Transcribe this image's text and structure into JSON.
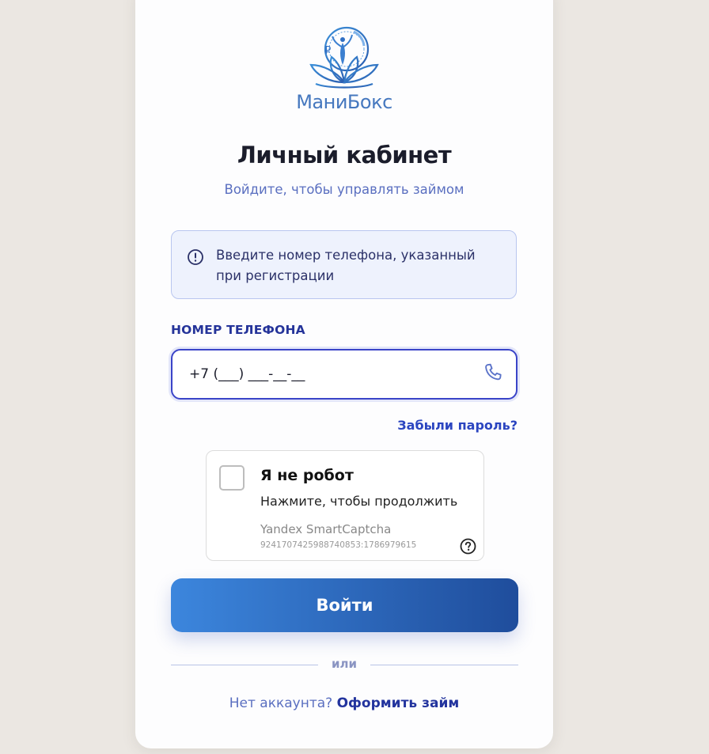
{
  "brand": {
    "name": "МаниБокс",
    "logo_icon": "lotus-coin-logo",
    "color": "#4678bf"
  },
  "header": {
    "title": "Личный кабинет",
    "subtitle": "Войдите, чтобы управлять займом"
  },
  "info": {
    "icon": "info-circle-icon",
    "text": "Введите номер телефона, указанный при регистрации"
  },
  "phone": {
    "label": "НОМЕР ТЕЛЕФОНА",
    "value": "+7 (___) ___-__-__",
    "icon": "phone-icon"
  },
  "forgot_password": "Забыли пароль?",
  "captcha": {
    "title": "Я не робот",
    "subtitle": "Нажмите, чтобы продолжить",
    "brand": "Yandex SmartCaptcha",
    "id": "9241707425988740853:1786979615",
    "checked": false
  },
  "login_button": "Войти",
  "divider": "или",
  "register": {
    "question": "Нет аккаунта?",
    "link": "Оформить займ"
  },
  "colors": {
    "accent": "#3a44c8",
    "button_start": "#3c86dd",
    "button_end": "#1f4d9c",
    "background": "#ebe7e2"
  }
}
